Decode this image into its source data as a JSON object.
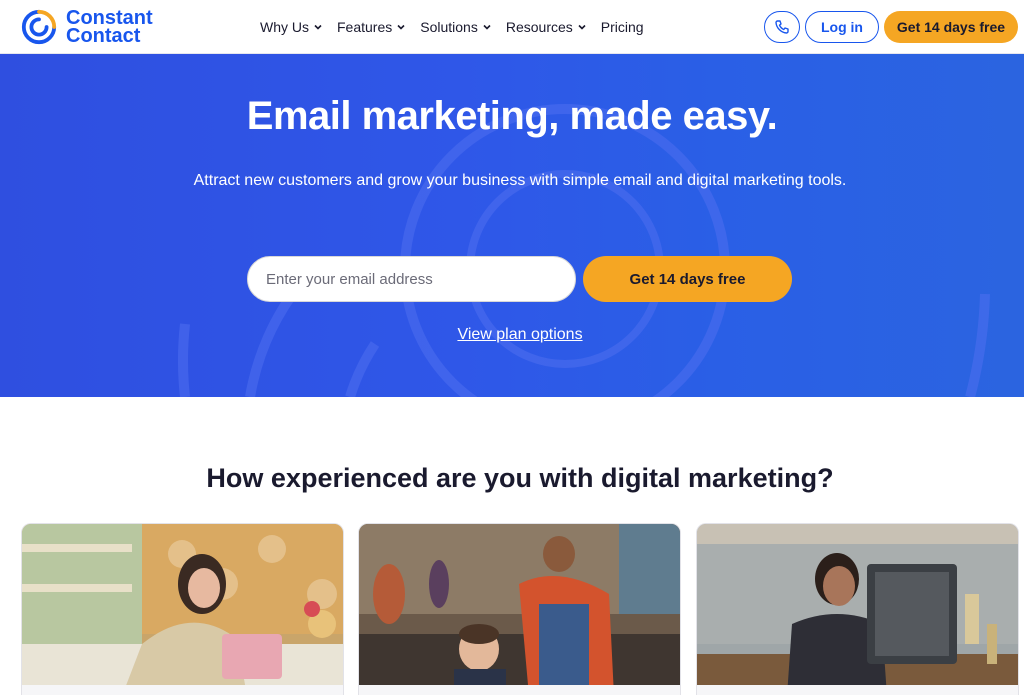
{
  "brand": {
    "name_line1": "Constant",
    "name_line2": "Contact",
    "color": "#1856ed",
    "accent": "#f5a623"
  },
  "nav": {
    "items": [
      {
        "label": "Why Us",
        "has_dropdown": true
      },
      {
        "label": "Features",
        "has_dropdown": true
      },
      {
        "label": "Solutions",
        "has_dropdown": true
      },
      {
        "label": "Resources",
        "has_dropdown": true
      },
      {
        "label": "Pricing",
        "has_dropdown": false
      }
    ],
    "phone_icon": "phone-icon",
    "login_label": "Log in",
    "trial_label": "Get 14 days free"
  },
  "hero": {
    "title": "Email marketing, made easy.",
    "subtitle": "Attract new customers and grow your business with simple email and digital marketing tools.",
    "email_placeholder": "Enter your email address",
    "cta_label": "Get 14 days free",
    "plan_link": "View plan options",
    "bg_color": "#2f55e6"
  },
  "section": {
    "title": "How experienced are you with digital marketing?",
    "cards": [
      {
        "image": "woman-at-laptop-in-shop-photo"
      },
      {
        "image": "barber-cutting-boys-hair-photo"
      },
      {
        "image": "woman-at-front-desk-computer-photo"
      }
    ]
  }
}
